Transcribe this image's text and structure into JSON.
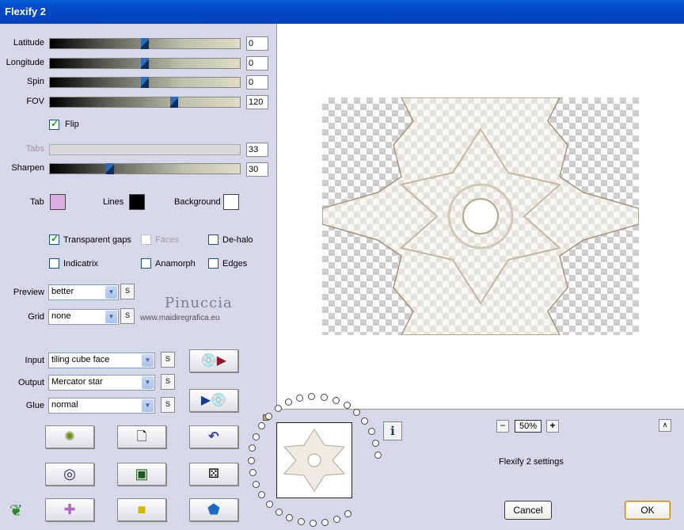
{
  "window": {
    "title": "Flexify 2"
  },
  "sliders": [
    {
      "label": "Latitude",
      "value": "0",
      "level": 0.5,
      "enabled": true
    },
    {
      "label": "Longitude",
      "value": "0",
      "level": 0.5,
      "enabled": true
    },
    {
      "label": "Spin",
      "value": "0",
      "level": 0.5,
      "enabled": true
    },
    {
      "label": "FOV",
      "value": "120",
      "level": 0.66,
      "enabled": true
    },
    {
      "label": "Tabs",
      "value": "33",
      "level": 0.0,
      "enabled": false
    },
    {
      "label": "Sharpen",
      "value": "30",
      "level": 0.31,
      "enabled": true
    }
  ],
  "flip": {
    "label": "Flip",
    "checked": true
  },
  "colors": {
    "tab": {
      "label": "Tab",
      "color": "#d9aee0"
    },
    "lines": {
      "label": "Lines",
      "color": "#000000"
    },
    "background": {
      "label": "Background",
      "color": "#ffffff"
    }
  },
  "options": {
    "transparent_gaps": {
      "label": "Transparent gaps",
      "checked": true
    },
    "faces": {
      "label": "Faces",
      "checked": false,
      "enabled": false
    },
    "de_halo": {
      "label": "De-halo",
      "checked": false
    },
    "indicatrix": {
      "label": "Indicatrix",
      "checked": false
    },
    "anamorph": {
      "label": "Anamorph",
      "checked": false
    },
    "edges": {
      "label": "Edges",
      "checked": false
    }
  },
  "preview_select": {
    "label": "Preview",
    "value": "better"
  },
  "grid_select": {
    "label": "Grid",
    "value": "none"
  },
  "input_select": {
    "label": "Input",
    "value": "tiling cube face"
  },
  "output_select": {
    "label": "Output",
    "value": "Mercator star"
  },
  "glue_select": {
    "label": "Glue",
    "value": "normal"
  },
  "s_button": "S",
  "watermark": {
    "name": "Pinuccia",
    "url": "www.maidiregrafica.eu"
  },
  "zoom": {
    "minus": "−",
    "value": "50%",
    "plus": "+"
  },
  "settings_caption": "Flexify 2 settings",
  "info_icon": "i",
  "collapse_icon": "∧",
  "buttons": {
    "cancel": "Cancel",
    "ok": "OK"
  }
}
